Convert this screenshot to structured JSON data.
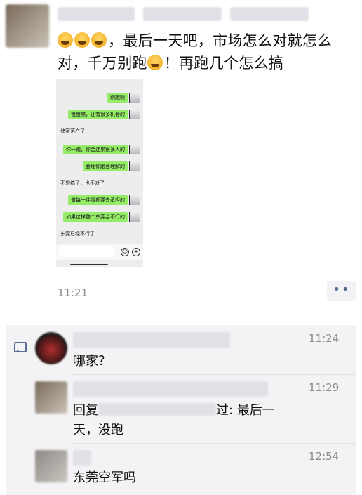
{
  "post": {
    "text": "，最后一天吧，市场怎么对就怎么对，千万别跑",
    "text_tail": "！再跑几个怎么搞",
    "time": "11:21",
    "more_label": "••"
  },
  "chat_image": {
    "messages": [
      {
        "side": "me",
        "text": "别跑啊"
      },
      {
        "side": "me",
        "text": "慢慢熬，还有很多机会的"
      },
      {
        "side": "them",
        "text": "储家落产了"
      },
      {
        "side": "me",
        "text": "你一跑，你会连累很多人的"
      },
      {
        "side": "me",
        "text": "会理你跑会理解的"
      },
      {
        "side": "them",
        "text": "不想搞了，也不对了"
      },
      {
        "side": "me",
        "text": "做每一件事都要去承担的"
      },
      {
        "side": "me",
        "text": "如果这样整个东莞会不行的"
      },
      {
        "side": "them",
        "text": "东莞已经不行了"
      }
    ]
  },
  "comments": [
    {
      "time": "11:24",
      "text": "哪家？"
    },
    {
      "time": "11:29",
      "text_lines": [
        "回复",
        "过: 最后一",
        "天，没跑"
      ]
    },
    {
      "time": "12:54",
      "text": "东莞空军吗"
    }
  ],
  "colors": {
    "link": "#576b95",
    "bubble": "#95ec69",
    "panel": "#f3f3f5"
  }
}
